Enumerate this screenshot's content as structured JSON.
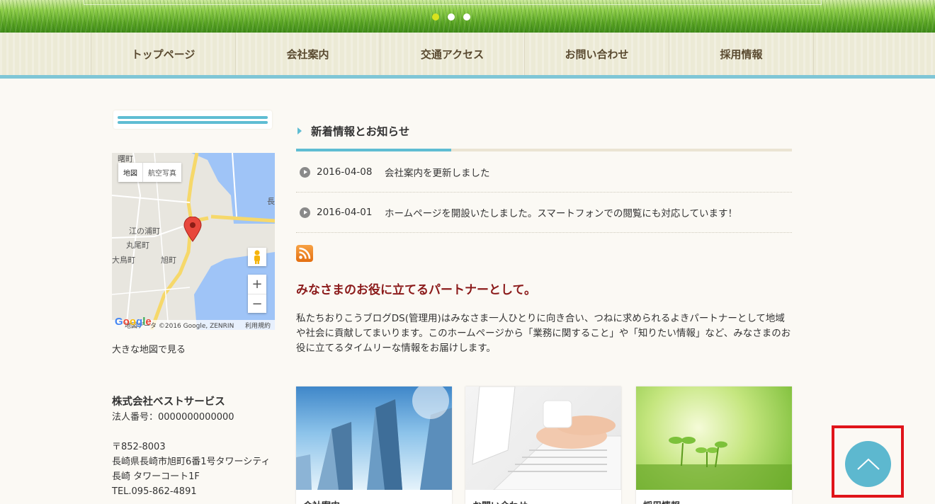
{
  "slider": {
    "dots": 3,
    "active_dot": 0
  },
  "nav": {
    "items": [
      {
        "label": "トップページ"
      },
      {
        "label": "会社案内"
      },
      {
        "label": "交通アクセス"
      },
      {
        "label": "お問い合わせ"
      },
      {
        "label": "採用情報"
      }
    ]
  },
  "map": {
    "btn_map": "地図",
    "btn_satellite": "航空写真",
    "labels": {
      "a": "江の浦町",
      "b": "丸尾町",
      "c": "大鳥町",
      "d": "旭町",
      "e": "曙町",
      "f": "長"
    },
    "zoom_in": "+",
    "zoom_out": "−",
    "copyright": "地図データ ©2016 Google, ZENRIN",
    "terms": "利用規約",
    "google": "Google",
    "big_map_link": "大きな地図で見る"
  },
  "company": {
    "name": "株式会社ベストサービス",
    "corp_no": "法人番号：0000000000000",
    "postal": "〒852-8003",
    "address": "長崎県長崎市旭町6番1号タワーシティ長崎 タワーコート1F",
    "tel": "TEL.095-862-4891"
  },
  "news": {
    "title": "新着情報とお知らせ",
    "items": [
      {
        "date": "2016-04-08",
        "text": "会社案内を更新しました"
      },
      {
        "date": "2016-04-01",
        "text": "ホームページを開設いたしました。スマートフォンでの閲覧にも対応しています！"
      }
    ]
  },
  "intro": {
    "tagline": "みなさまのお役に立てるパートナーとして。",
    "body": "私たちおりこうブログDS(管理用)はみなさま一人ひとりに向き合い、つねに求められるよきパートナーとして地域や社会に貢献してまいります。このホームページから「業務に関すること」や「知りたい情報」など、みなさまのお役に立てるタイムリーな情報をお届けします。"
  },
  "cards": [
    {
      "label": "会社案内"
    },
    {
      "label": "お問い合わせ"
    },
    {
      "label": "採用情報"
    }
  ],
  "colors": {
    "accent": "#5fbdd3",
    "tagline": "#8b1a1a",
    "highlight": "#e0141a",
    "totop": "#5db8cf"
  },
  "icons": {
    "rss": "rss-icon",
    "totop": "chevron-up-icon",
    "news": "play-circle-icon",
    "pin": "map-pin-icon"
  }
}
